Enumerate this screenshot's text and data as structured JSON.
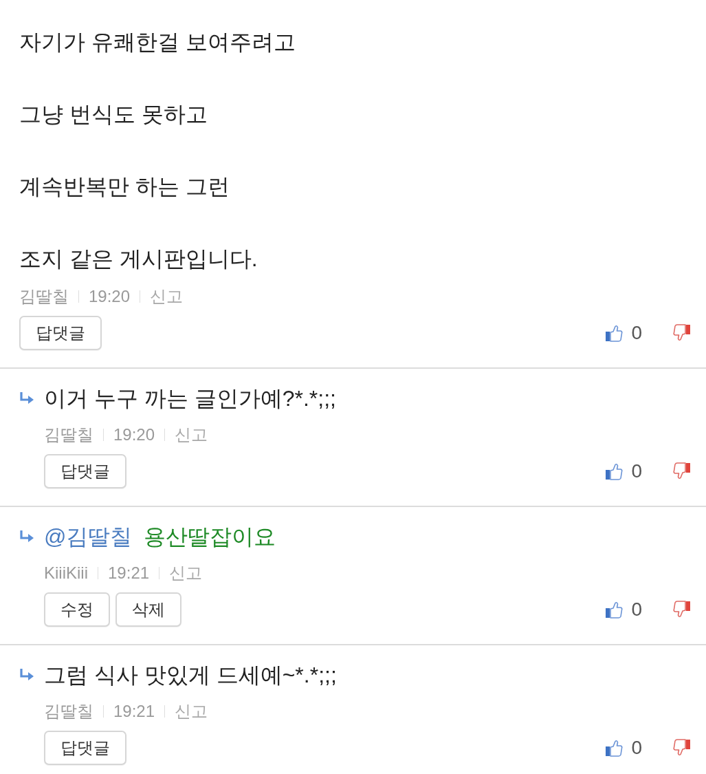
{
  "comments": [
    {
      "kind": "comment",
      "body": [
        "자기가 유쾌한걸 보여주려고",
        "그냥 번식도 못하고",
        "계속반복만 하는 그런",
        "조지 같은 게시판입니다."
      ],
      "mine": false,
      "author": "김딸칠",
      "time": "19:20",
      "report": "신고",
      "buttons": [
        "답댓글"
      ],
      "likes": "0"
    },
    {
      "kind": "reply",
      "body": [
        "이거 누구 까는 글인가예?*.*;;;"
      ],
      "mine": false,
      "author": "김딸칠",
      "time": "19:20",
      "report": "신고",
      "buttons": [
        "답댓글"
      ],
      "likes": "0"
    },
    {
      "kind": "reply",
      "mention": "@김딸칠",
      "body": [
        "용산딸잡이요"
      ],
      "mine": true,
      "author": "KiiiKiii",
      "time": "19:21",
      "report": "신고",
      "buttons": [
        "수정",
        "삭제"
      ],
      "likes": "0"
    },
    {
      "kind": "reply",
      "body": [
        "그럼 식사 맛있게 드세예~*.*;;;"
      ],
      "mine": false,
      "author": "김딸칠",
      "time": "19:21",
      "report": "신고",
      "buttons": [
        "답댓글"
      ],
      "likes": "0"
    }
  ]
}
